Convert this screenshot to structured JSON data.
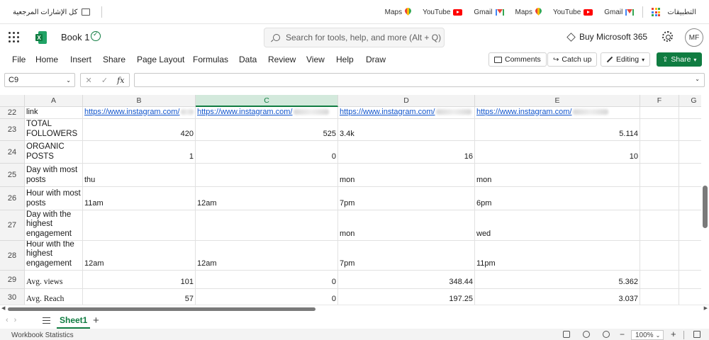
{
  "bookmarks": {
    "right_items": [
      {
        "label": "التطبيقات",
        "icon": "apps-grid-icon"
      },
      {
        "label": "Gmail",
        "icon": "gmail-icon"
      },
      {
        "label": "YouTube",
        "icon": "youtube-icon"
      },
      {
        "label": "Maps",
        "icon": "maps-icon"
      },
      {
        "label": "Gmail",
        "icon": "gmail-icon"
      },
      {
        "label": "YouTube",
        "icon": "youtube-icon"
      },
      {
        "label": "Maps",
        "icon": "maps-icon"
      }
    ],
    "all_bookmarks": "كل الإشارات المرجعية"
  },
  "titlebar": {
    "book_title": "Book 1",
    "search_placeholder": "Search for tools, help, and more (Alt + Q)",
    "buy_label": "Buy Microsoft 365",
    "avatar_initials": "MF"
  },
  "ribbon": {
    "tabs": [
      "File",
      "Home",
      "Insert",
      "Share",
      "Page Layout",
      "Formulas",
      "Data",
      "Review",
      "View",
      "Help",
      "Draw"
    ],
    "comments_label": "Comments",
    "catchup_label": "Catch up",
    "editing_label": "Editing",
    "share_label": "Share"
  },
  "formula_bar": {
    "name_box": "C9",
    "fx_label": "fx",
    "formula": ""
  },
  "grid": {
    "columns": [
      "A",
      "B",
      "C",
      "D",
      "E",
      "F",
      "G"
    ],
    "selected_column": "C",
    "rows": [
      {
        "num": "22",
        "cells": [
          "link",
          "https://www.instagram.com/",
          "https://www.instagram.com/",
          "https://www.instagram.com/",
          "https://www.instagram.com/"
        ]
      },
      {
        "num": "23",
        "cells": [
          "TOTAL FOLLOWERS",
          "420",
          "525",
          "3.4k",
          "5.114"
        ]
      },
      {
        "num": "24",
        "cells": [
          "ORGANIC POSTS",
          "1",
          "0",
          "16",
          "10"
        ]
      },
      {
        "num": "25",
        "cells": [
          "Day with most posts",
          "thu",
          "",
          "mon",
          "mon"
        ]
      },
      {
        "num": "26",
        "cells": [
          "Hour with most posts",
          "11am",
          "12am",
          "7pm",
          "6pm"
        ]
      },
      {
        "num": "27",
        "cells": [
          "Day with the highest engagement",
          "",
          "",
          "mon",
          "wed"
        ]
      },
      {
        "num": "28",
        "cells": [
          "Hour with the highest engagement",
          "12am",
          "12am",
          "7pm",
          "11pm"
        ]
      },
      {
        "num": "29",
        "cells": [
          "Avg. views",
          "101",
          "0",
          "348.44",
          "5.362"
        ]
      },
      {
        "num": "30",
        "cells": [
          "Avg. Reach",
          "57",
          "0",
          "197.25",
          "3.037"
        ]
      }
    ]
  },
  "sheets": {
    "active": "Sheet1"
  },
  "status": {
    "workbook_stats": "Workbook Statistics",
    "zoom": "100%"
  },
  "colors": {
    "excel_green": "#107c41",
    "link_blue": "#1155cc"
  }
}
